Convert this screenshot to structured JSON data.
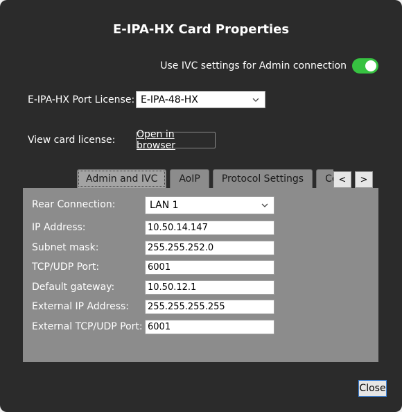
{
  "dialog": {
    "title": "E-IPA-HX Card Properties",
    "ivc_toggle": {
      "label": "Use IVC settings for Admin connection",
      "on": true,
      "color": "#37c241"
    },
    "port_license": {
      "label": "E-IPA-HX Port License:",
      "value": "E-IPA-48-HX"
    },
    "card_license": {
      "label": "View card license:",
      "button": "Open in browser"
    },
    "tabs": [
      {
        "label": "Admin and IVC",
        "active": true
      },
      {
        "label": "AoIP"
      },
      {
        "label": "Protocol Settings"
      },
      {
        "label": "Co"
      }
    ],
    "tab_prev": "<",
    "tab_next": ">",
    "admin": {
      "rear_connection": {
        "label": "Rear Connection:",
        "value": "LAN 1"
      },
      "ip_address": {
        "label": "IP Address:",
        "value": "10.50.14.147"
      },
      "subnet_mask": {
        "label": "Subnet mask:",
        "value": "255.255.252.0"
      },
      "tcp_udp_port": {
        "label": "TCP/UDP Port:",
        "value": "6001"
      },
      "default_gateway": {
        "label": "Default gateway:",
        "value": "10.50.12.1"
      },
      "external_ip": {
        "label": "External IP Address:",
        "value": "255.255.255.255"
      },
      "external_port": {
        "label": "External TCP/UDP Port:",
        "value": "6001"
      }
    },
    "close": "Close"
  }
}
